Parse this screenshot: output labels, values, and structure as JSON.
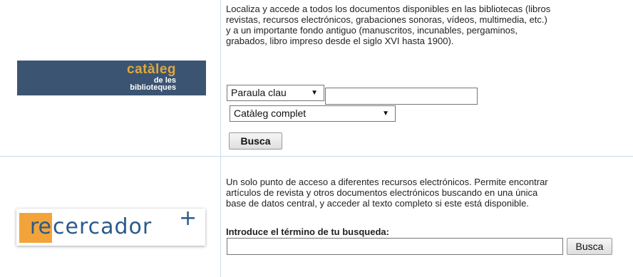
{
  "catalog": {
    "logo": {
      "line1": "catàleg",
      "line2": "de les",
      "line3": "biblioteques"
    },
    "description_lines": [
      "Localiza y accede a todos los documentos disponibles en las bibliotecas (libros",
      "revistas, recursos electrónicos, grabaciones sonoras, vídeos, multimedia, etc.)",
      "y a un importante fondo antiguo (manuscritos, incunables, pergaminos,",
      "grabados, libro impreso desde el siglo XVI hasta 1900)."
    ],
    "search_type_selected": "Paraula clau",
    "search_input_value": "",
    "scope_selected": "Catàleg complet",
    "search_button": "Busca"
  },
  "recercador": {
    "logo": {
      "re": "re",
      "rest": "cercador",
      "plus": "+"
    },
    "logo_colors": {
      "orange": "#f2a43a",
      "blue": "#2b5a8a"
    },
    "description_lines": [
      "Un solo punto de acceso a diferentes recursos electrónicos. Permite encontrar",
      "artículos de revista y otros documentos electrónicos buscando en una única",
      "base de datos central, y acceder al texto completo si este está disponible."
    ],
    "term_label": "Introduce el término de tu busqueda:",
    "term_input_value": "",
    "search_button": "Busca"
  },
  "colors": {
    "catalog_logo_bg": "#3b5472",
    "catalog_logo_accent": "#e0a83a",
    "divider": "#c9dbea"
  }
}
